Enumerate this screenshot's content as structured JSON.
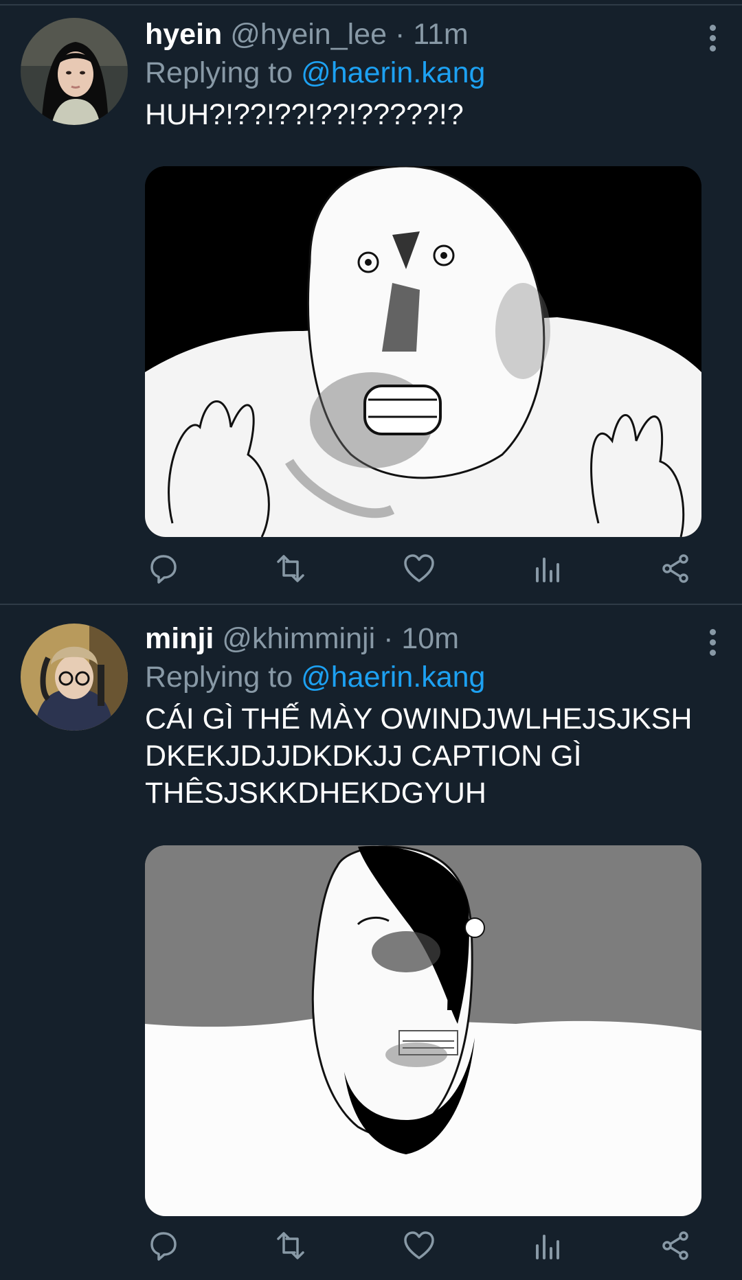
{
  "tweets": [
    {
      "name": "hyein",
      "handle": "@hyein_lee",
      "time": "11m",
      "replying_prefix": "Replying to",
      "replying_to": "@haerin.kang",
      "text": "HUH?!??!??!??!?????!?",
      "media_alt": "drawn meme face screaming with hands raised"
    },
    {
      "name": "minji",
      "handle": "@khimminji",
      "time": "10m",
      "replying_prefix": "Replying to",
      "replying_to": "@haerin.kang",
      "text": "CÁI GÌ THẾ MÀY OWINDJWLHEJSJKSH\nDKEKJDJJDKDKJJ CAPTION GÌ\nTHÊSJSKKDHEKDGYUH",
      "media_alt": "drawn meme face with black hair on gray background"
    }
  ],
  "separator": "·",
  "icons": [
    "reply-icon",
    "retweet-icon",
    "like-icon",
    "analytics-icon",
    "share-icon",
    "more-icon"
  ],
  "colors": {
    "background": "#15202b",
    "secondary_text": "#8899a6",
    "mention": "#1da1f2"
  }
}
